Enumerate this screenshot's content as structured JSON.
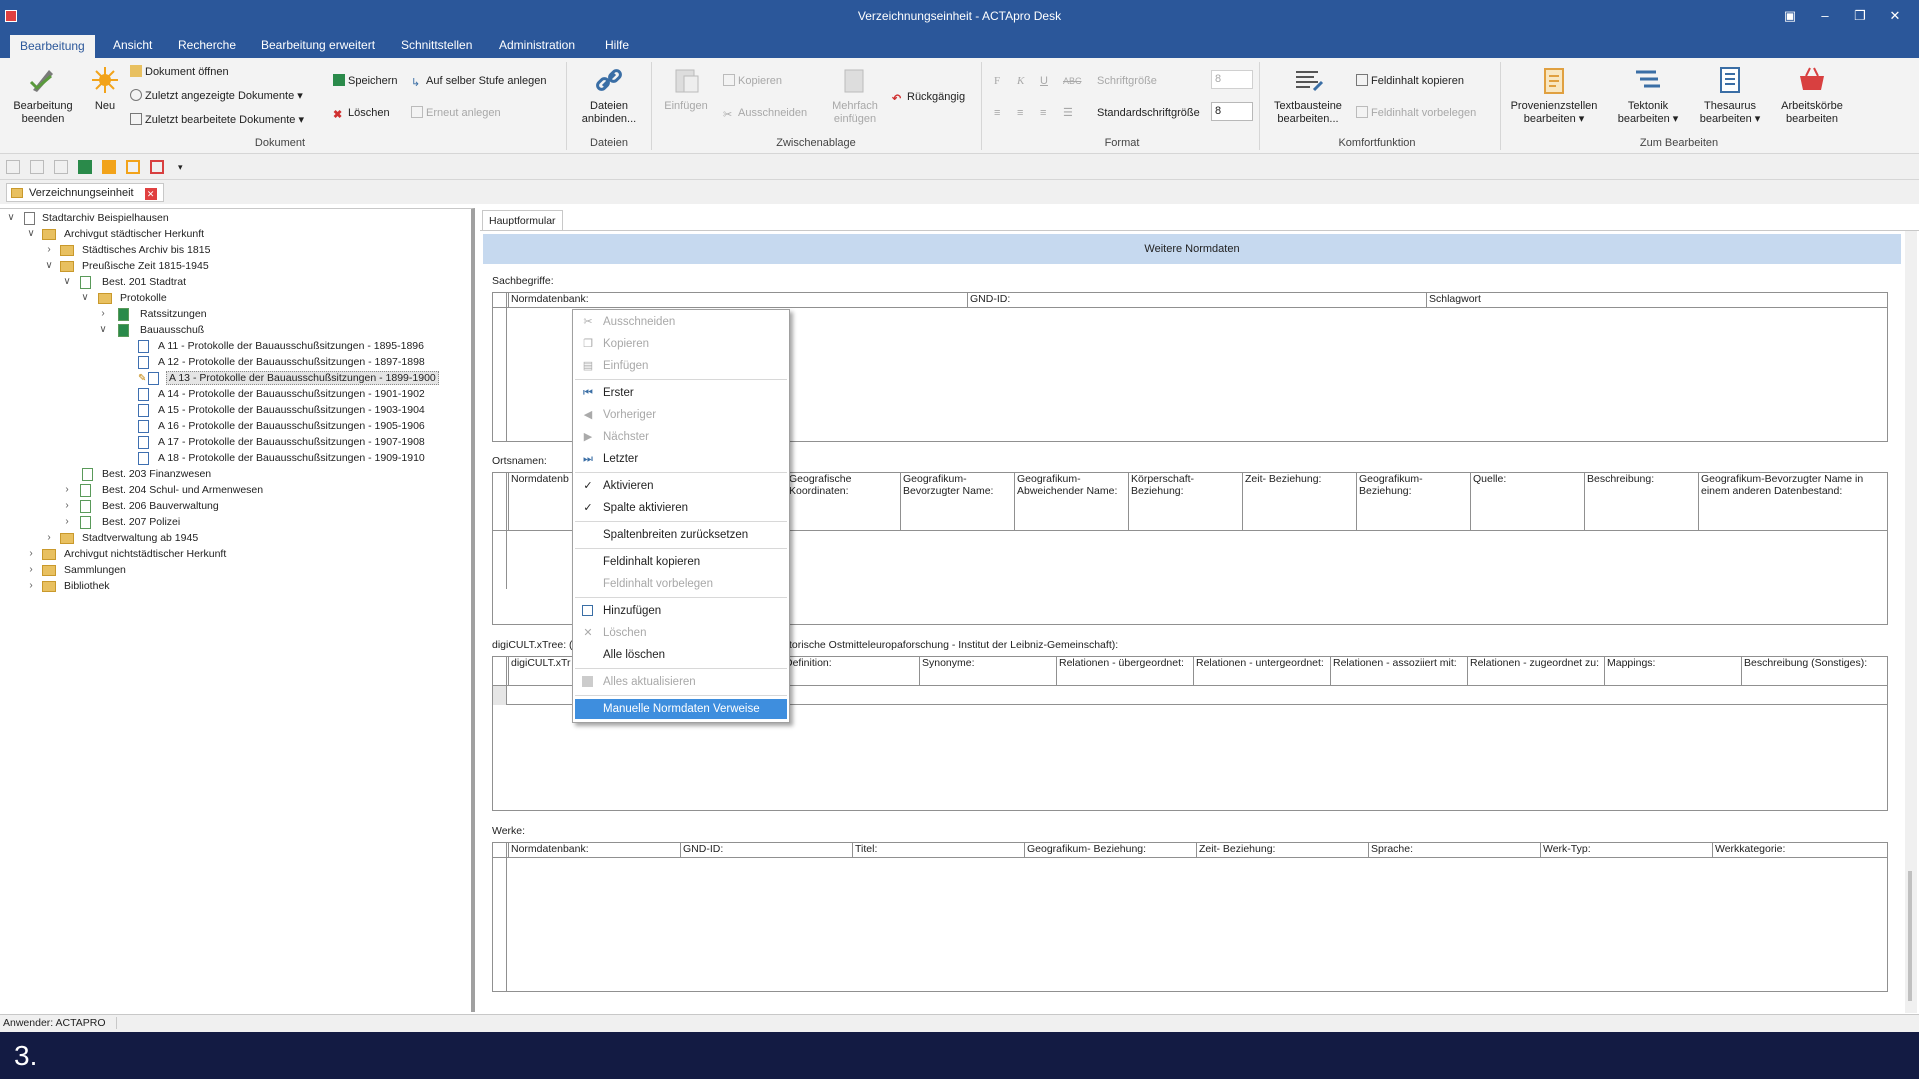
{
  "window": {
    "title": "Verzeichnungseinheit - ACTApro Desk"
  },
  "menu_tabs": [
    "Bearbeitung",
    "Ansicht",
    "Recherche",
    "Bearbeitung erweitert",
    "Schnittstellen",
    "Administration",
    "Hilfe"
  ],
  "ribbon": {
    "dokument": {
      "group": "Dokument",
      "bearbeitung_beenden": "Bearbeitung beenden",
      "neu": "Neu",
      "dokument_oeffnen": "Dokument öffnen",
      "zuletzt_angezeigt": "Zuletzt angezeigte Dokumente",
      "zuletzt_bearbeitet": "Zuletzt bearbeitete Dokumente",
      "speichern": "Speichern",
      "loeschen": "Löschen",
      "auf_selber_stufe": "Auf selber Stufe anlegen",
      "erneut_anlegen": "Erneut anlegen"
    },
    "dateien": {
      "group": "Dateien",
      "dateien_anbinden": "Dateien anbinden..."
    },
    "zwischenablage": {
      "group": "Zwischenablage",
      "einfuegen": "Einfügen",
      "kopieren": "Kopieren",
      "ausschneiden": "Ausschneiden",
      "mehrfach_einfuegen": "Mehrfach einfügen",
      "rueckgaengig": "Rückgängig"
    },
    "format": {
      "group": "Format",
      "schriftgroesse": "Schriftgröße",
      "schriftgroesse_val": "8",
      "standardschriftgroesse": "Standardschriftgröße",
      "standardschriftgroesse_val": "8"
    },
    "komfort": {
      "group": "Komfortfunktion",
      "textbausteine": "Textbausteine bearbeiten...",
      "feldinhalt_kopieren": "Feldinhalt kopieren",
      "feldinhalt_vorbelegen": "Feldinhalt vorbelegen"
    },
    "zum_bearbeiten": {
      "group": "Zum Bearbeiten",
      "provenienz": "Provenienzstellen bearbeiten",
      "tektonik": "Tektonik bearbeiten",
      "thesaurus": "Thesaurus bearbeiten",
      "arbeitskoerbe": "Arbeitskörbe bearbeiten"
    }
  },
  "doc_tab": "Verzeichnungseinheit",
  "tree": [
    "Stadtarchiv Beispielhausen",
    "Archivgut städtischer Herkunft",
    "Städtisches Archiv bis 1815",
    "Preußische Zeit 1815-1945",
    "Best. 201 Stadtrat",
    "Protokolle",
    "Ratssitzungen",
    "Bauausschuß",
    "A 11 - Protokolle der Bauausschußsitzungen - 1895-1896",
    "A 12 - Protokolle der Bauausschußsitzungen - 1897-1898",
    "A 13 - Protokolle der Bauausschußsitzungen - 1899-1900",
    "A 14 - Protokolle der Bauausschußsitzungen - 1901-1902",
    "A 15 - Protokolle der Bauausschußsitzungen - 1903-1904",
    "A 16 - Protokolle der Bauausschußsitzungen - 1905-1906",
    "A 17 - Protokolle der Bauausschußsitzungen - 1907-1908",
    "A 18 - Protokolle der Bauausschußsitzungen - 1909-1910",
    "Best. 203 Finanzwesen",
    "Best. 204 Schul- und Armenwesen",
    "Best. 206 Bauverwaltung",
    "Best. 207 Polizei",
    "Stadtverwaltung ab 1945",
    "Archivgut nichtstädtischer Herkunft",
    "Sammlungen",
    "Bibliothek"
  ],
  "main": {
    "tab": "Hauptformular",
    "banner": "Weitere Normdaten",
    "sachbegriffe": {
      "label": "Sachbegriffe:",
      "cols": [
        "Normdatenbank:",
        "GND-ID:",
        "Schlagwort"
      ]
    },
    "ortsnamen": {
      "label": "Ortsnamen:",
      "cols": [
        "Normdatenb",
        "Geografische Koordinaten:",
        "Geografikum-Bevorzugter Name:",
        "Geografikum-Abweichender Name:",
        "Körperschaft-Beziehung:",
        "Zeit- Beziehung:",
        "Geografikum-Beziehung:",
        "Quelle:",
        "Beschreibung:",
        "Geografikum-Bevorzugter Name in einem anderen Datenbestand:"
      ]
    },
    "digicult": {
      "label_left": "digiCULT.xTree: (",
      "label_right": "torische Ostmitteleuropaforschung - Institut der Leibniz-Gemeinschaft):",
      "cols": [
        "digiCULT.xTr",
        "Definition:",
        "Synonyme:",
        "Relationen - übergeordnet:",
        "Relationen - untergeordnet:",
        "Relationen - assoziiert mit:",
        "Relationen - zugeordnet zu:",
        "Mappings:",
        "Beschreibung (Sonstiges):"
      ]
    },
    "werke": {
      "label": "Werke:",
      "cols": [
        "Normdatenbank:",
        "GND-ID:",
        "Titel:",
        "Geografikum- Beziehung:",
        "Zeit- Beziehung:",
        "Sprache:",
        "Werk-Typ:",
        "Werkkategorie:"
      ]
    }
  },
  "context_menu": {
    "ausschneiden": "Ausschneiden",
    "kopieren": "Kopieren",
    "einfuegen": "Einfügen",
    "erster": "Erster",
    "vorheriger": "Vorheriger",
    "naechster": "Nächster",
    "letzter": "Letzter",
    "aktivieren": "Aktivieren",
    "spalte_aktivieren": "Spalte aktivieren",
    "spaltenbreiten": "Spaltenbreiten zurücksetzen",
    "feldinhalt_kopieren": "Feldinhalt kopieren",
    "feldinhalt_vorbelegen": "Feldinhalt vorbelegen",
    "hinzufuegen": "Hinzufügen",
    "loeschen": "Löschen",
    "alle_loeschen": "Alle löschen",
    "alles_aktualisieren": "Alles aktualisieren",
    "manuelle_normdaten": "Manuelle Normdaten Verweise"
  },
  "status": {
    "user": "Anwender: ACTAPRO"
  },
  "caption": "3.",
  "colors": {
    "accent": "#2b579a",
    "highlight": "#3e8ede",
    "banner": "#c6d9ef",
    "caption_bg": "#131b43"
  }
}
